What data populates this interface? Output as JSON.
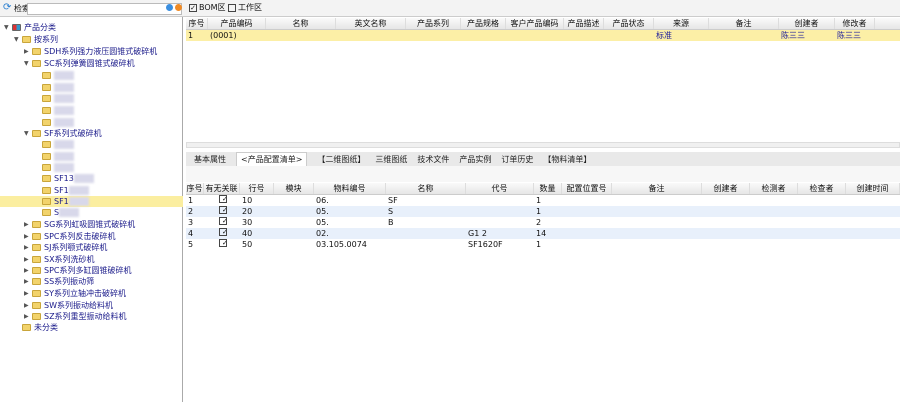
{
  "toolbar": {
    "search_label": "检索",
    "checkbox1": "BOM区",
    "checkbox2": "工作区"
  },
  "tree": [
    {
      "label": "产品分类",
      "level": 0,
      "arrow": "▼",
      "root": true
    },
    {
      "label": "按系列",
      "level": 1,
      "arrow": "▼"
    },
    {
      "label": "SDH系列强力液压圆锥式破碎机",
      "level": 2,
      "arrow": "▶"
    },
    {
      "label": "SC系列弹簧圆锥式破碎机",
      "level": 2,
      "arrow": "▼"
    },
    {
      "label": "",
      "level": 3
    },
    {
      "label": "",
      "level": 3
    },
    {
      "label": "",
      "level": 3
    },
    {
      "label": "",
      "level": 3
    },
    {
      "label": "",
      "level": 3
    },
    {
      "label": "SF系列式破碎机",
      "level": 2,
      "arrow": "▼"
    },
    {
      "label": "",
      "level": 3
    },
    {
      "label": "",
      "level": 3
    },
    {
      "label": "",
      "level": 3
    },
    {
      "label": "SF13",
      "level": 3
    },
    {
      "label": "SF1",
      "level": 3
    },
    {
      "label": "SF1",
      "level": 3,
      "selected": true
    },
    {
      "label": "S",
      "level": 3
    },
    {
      "label": "SG系列虹吸圆锥式破碎机",
      "level": 2,
      "arrow": "▶"
    },
    {
      "label": "SPC系列反击破碎机",
      "level": 2,
      "arrow": "▶"
    },
    {
      "label": "SJ系列颚式破碎机",
      "level": 2,
      "arrow": "▶"
    },
    {
      "label": "SX系列洗砂机",
      "level": 2,
      "arrow": "▶"
    },
    {
      "label": "SPC系列多缸圆锥破碎机",
      "level": 2,
      "arrow": "▶"
    },
    {
      "label": "SS系列振动筛",
      "level": 2,
      "arrow": "▶"
    },
    {
      "label": "SY系列立轴冲击破碎机",
      "level": 2,
      "arrow": "▶"
    },
    {
      "label": "SW系列振动给料机",
      "level": 2,
      "arrow": "▶"
    },
    {
      "label": "SZ系列重型振动给料机",
      "level": 2,
      "arrow": "▶"
    },
    {
      "label": "未分类",
      "level": 1
    }
  ],
  "top_grid": {
    "columns": [
      "序号",
      "产品编码",
      "名称",
      "英文名称",
      "产品系列",
      "产品规格",
      "客户产品编码",
      "产品描述",
      "产品状态",
      "来源",
      "备注",
      "创建者",
      "修改者"
    ],
    "rows": [
      [
        "1",
        "(0001)",
        "",
        "",
        "",
        "",
        "",
        "",
        "",
        "标准",
        "",
        "陈三三",
        "陈三三"
      ]
    ]
  },
  "tabs": [
    "基本属性",
    "<产品配置清单>",
    "【二维图纸】",
    "三维图纸",
    "技术文件",
    "产品实例",
    "订单历史",
    "【物料清单】"
  ],
  "bottom_grid": {
    "columns": [
      "序号",
      "有无关联",
      "行号",
      "模块",
      "物料编号",
      "名称",
      "代号",
      "数量",
      "配置位置号",
      "备注",
      "创建者",
      "检测者",
      "检查者",
      "创建时间"
    ],
    "rows": [
      [
        "1",
        "✓",
        "10",
        "",
        "06.",
        "SF",
        "",
        "1",
        "",
        "",
        "",
        "",
        "",
        ""
      ],
      [
        "2",
        "✓",
        "20",
        "",
        "05.",
        "S",
        "",
        "1",
        "",
        "",
        "",
        "",
        "",
        ""
      ],
      [
        "3",
        "✓",
        "30",
        "",
        "05.",
        "B",
        "",
        "2",
        "",
        "",
        "",
        "",
        "",
        ""
      ],
      [
        "4",
        "✓",
        "40",
        "",
        "02.",
        "",
        "G1 2",
        "14",
        "",
        "",
        "",
        "",
        "",
        ""
      ],
      [
        "5",
        "✓",
        "50",
        "",
        "03.105.0074",
        "",
        "SF1620F",
        "1",
        "",
        "",
        "",
        "",
        "",
        ""
      ]
    ]
  }
}
